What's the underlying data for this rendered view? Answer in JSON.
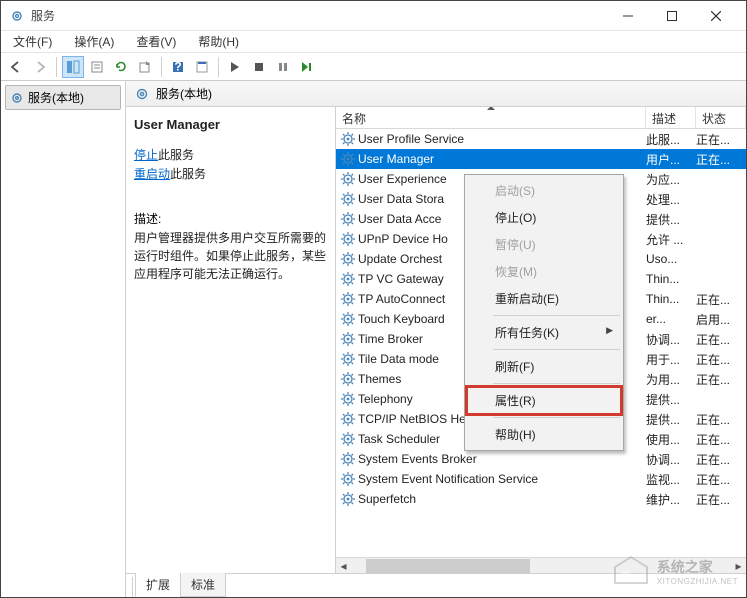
{
  "window": {
    "title": "服务"
  },
  "menus": {
    "file": "文件(F)",
    "action": "操作(A)",
    "view": "查看(V)",
    "help": "帮助(H)"
  },
  "nav": {
    "local_services": "服务(本地)"
  },
  "content_header": {
    "title": "服务(本地)"
  },
  "detail": {
    "title": "User Manager",
    "stop_link": "停止",
    "stop_rest": "此服务",
    "restart_link": "重启动",
    "restart_rest": "此服务",
    "desc_label": "描述:",
    "desc": "用户管理器提供多用户交互所需要的运行时组件。如果停止此服务，某些应用程序可能无法正确运行。"
  },
  "columns": {
    "name": "名称",
    "desc": "描述",
    "status": "状态"
  },
  "services": [
    {
      "name": "User Profile Service",
      "desc": "此服...",
      "status": "正在..."
    },
    {
      "name": "User Manager",
      "desc": "用户...",
      "status": "正在...",
      "selected": true
    },
    {
      "name": "User Experience",
      "desc": "为应...",
      "status": ""
    },
    {
      "name": "User Data Stora",
      "desc": "处理...",
      "status": ""
    },
    {
      "name": "User Data Acce",
      "desc": "提供...",
      "status": ""
    },
    {
      "name": "UPnP Device Ho",
      "desc": "允许 ...",
      "status": ""
    },
    {
      "name": "Update Orchest",
      "desc": "Uso...",
      "status": ""
    },
    {
      "name": "TP VC Gateway ",
      "desc": "Thin...",
      "status": ""
    },
    {
      "name": "TP AutoConnect",
      "desc": "Thin...",
      "status": "正在..."
    },
    {
      "name": "Touch Keyboard",
      "desc": "er...",
      "status": "启用..."
    },
    {
      "name": "Time Broker",
      "desc": "协调...",
      "status": "正在..."
    },
    {
      "name": "Tile Data mode",
      "desc": "用于...",
      "status": "正在..."
    },
    {
      "name": "Themes",
      "desc": "为用...",
      "status": "正在..."
    },
    {
      "name": "Telephony",
      "desc": "提供...",
      "status": ""
    },
    {
      "name": "TCP/IP NetBIOS Helper",
      "desc": "提供...",
      "status": "正在..."
    },
    {
      "name": "Task Scheduler",
      "desc": "使用...",
      "status": "正在..."
    },
    {
      "name": "System Events Broker",
      "desc": "协调...",
      "status": "正在..."
    },
    {
      "name": "System Event Notification Service",
      "desc": "监视...",
      "status": "正在..."
    },
    {
      "name": "Superfetch",
      "desc": "维护...",
      "status": "正在..."
    }
  ],
  "context_menu": {
    "start": "启动(S)",
    "stop": "停止(O)",
    "pause": "暂停(U)",
    "resume": "恢复(M)",
    "restart": "重新启动(E)",
    "all_tasks": "所有任务(K)",
    "refresh": "刷新(F)",
    "properties": "属性(R)",
    "help": "帮助(H)"
  },
  "tabs": {
    "extended": "扩展",
    "standard": "标准"
  },
  "watermark": {
    "text": "系统之家",
    "sub": "XITONGZHIJIA.NET"
  }
}
